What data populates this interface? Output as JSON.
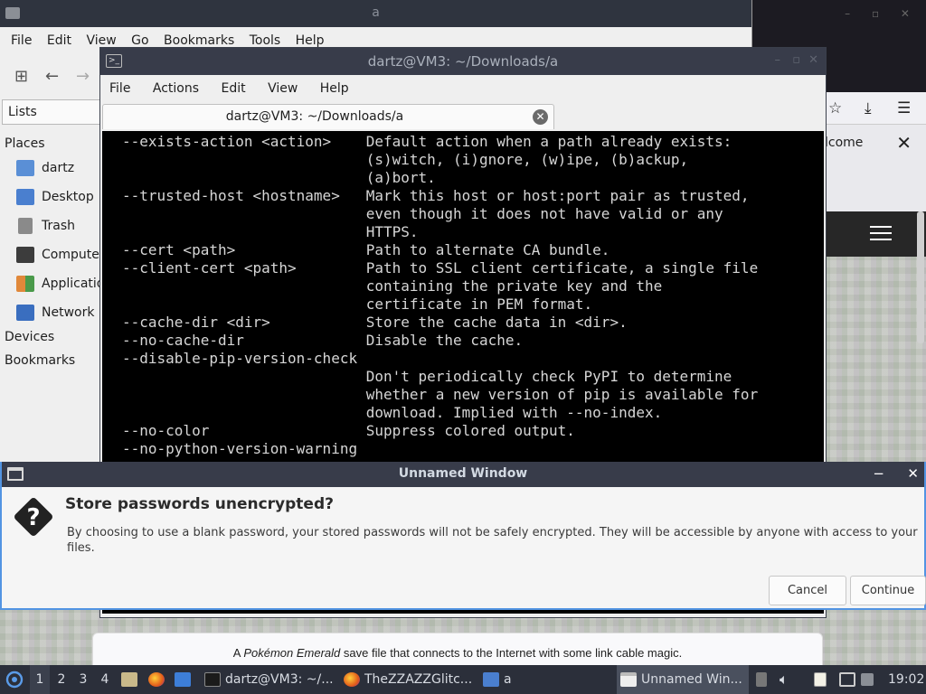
{
  "file_manager": {
    "title": "a",
    "menu": [
      "File",
      "Edit",
      "View",
      "Go",
      "Bookmarks",
      "Tools",
      "Help"
    ],
    "lists_header": "Lists",
    "places_label": "Places",
    "places": [
      {
        "label": "dartz",
        "icon": "home-folder-icon",
        "color": "#5a8fd6"
      },
      {
        "label": "Desktop",
        "icon": "desktop-icon",
        "color": "#4a7fcf"
      },
      {
        "label": "Trash",
        "icon": "trash-icon",
        "color": "#8a8a8a"
      },
      {
        "label": "Computer",
        "icon": "computer-icon",
        "color": "#3c3c3c"
      },
      {
        "label": "Applications",
        "icon": "applications-icon",
        "color": "#e0883a"
      },
      {
        "label": "Network",
        "icon": "network-icon",
        "color": "#3a6ebf"
      }
    ],
    "devices_label": "Devices",
    "bookmarks_label": "Bookmarks"
  },
  "firefox": {
    "welcome_text": "lcome",
    "strip_prefix": "A ",
    "strip_italic": "Pokémon Emerald",
    "strip_suffix": " save file that connects to the Internet with some link cable magic."
  },
  "terminal": {
    "title": "dartz@VM3: ~/Downloads/a",
    "menu": [
      "File",
      "Actions",
      "Edit",
      "View",
      "Help"
    ],
    "tab_label": "dartz@VM3: ~/Downloads/a",
    "lines": [
      "--exists-action <action>    Default action when a path already exists:",
      "                            (s)witch, (i)gnore, (w)ipe, (b)ackup,",
      "                            (a)bort.",
      "--trusted-host <hostname>   Mark this host or host:port pair as trusted,",
      "                            even though it does not have valid or any",
      "                            HTTPS.",
      "--cert <path>               Path to alternate CA bundle.",
      "--client-cert <path>        Path to SSL client certificate, a single file",
      "                            containing the private key and the",
      "                            certificate in PEM format.",
      "--cache-dir <dir>           Store the cache data in <dir>.",
      "--no-cache-dir              Disable the cache.",
      "--disable-pip-version-check",
      "                            Don't periodically check PyPI to determine",
      "                            whether a new version of pip is available for",
      "                            download. Implied with --no-index.",
      "--no-color                  Suppress colored output.",
      "--no-python-version-warning"
    ]
  },
  "dialog": {
    "title": "Unnamed Window",
    "heading": "Store passwords unencrypted?",
    "body": "By choosing to use a blank password, your stored passwords will not be safely encrypted. They will be accessible by anyone with access to your files.",
    "cancel_label": "Cancel",
    "continue_label": "Continue",
    "minimize_glyph": "−",
    "close_glyph": "✕"
  },
  "taskbar": {
    "workspaces": [
      "1",
      "2",
      "3",
      "4"
    ],
    "tasks": [
      {
        "label": "dartz@VM3: ~/...",
        "icon": "terminal-icon"
      },
      {
        "label": "TheZZAZZGlitc...",
        "icon": "firefox-icon"
      },
      {
        "label": "a",
        "icon": "folder-icon"
      },
      {
        "label": "Unnamed Win...",
        "icon": "window-icon"
      }
    ],
    "clock": "19:02"
  }
}
